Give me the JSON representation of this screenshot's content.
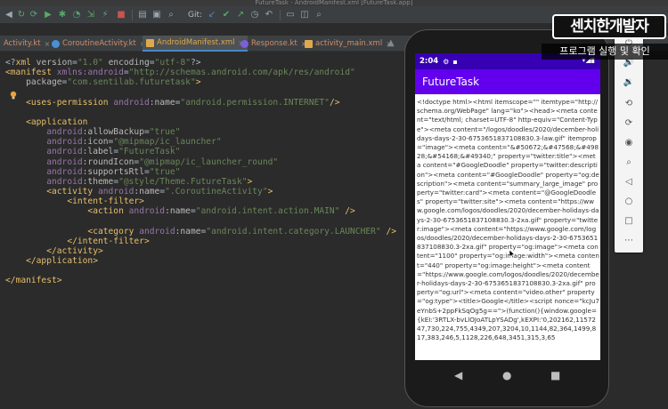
{
  "window": {
    "title": "FutureTask - AndroidManifest.xml [FutureTask.app]"
  },
  "toolbar": {
    "git_label": "Git:"
  },
  "tabs": [
    {
      "label": "Activity.kt",
      "type": "kt"
    },
    {
      "label": "CoroutineActivity.kt",
      "type": "kt"
    },
    {
      "label": "AndroidManifest.xml",
      "type": "xml"
    },
    {
      "label": "Response.kt",
      "type": "kt2"
    },
    {
      "label": "activity_main.xml",
      "type": "xml"
    }
  ],
  "editor": {
    "lines": [
      [
        [
          "t-txt",
          "<?"
        ],
        [
          "t-tag",
          "xml "
        ],
        [
          "t-attr",
          "version"
        ],
        [
          "t-txt",
          "="
        ],
        [
          "t-val",
          "\"1.0\""
        ],
        [
          "t-txt",
          " "
        ],
        [
          "t-attr",
          "encoding"
        ],
        [
          "t-txt",
          "="
        ],
        [
          "t-val",
          "\"utf-8\""
        ],
        [
          "t-txt",
          "?>"
        ]
      ],
      [
        [
          "t-tag",
          "<manifest "
        ],
        [
          "t-ns",
          "xmlns:android"
        ],
        [
          "t-txt",
          "="
        ],
        [
          "t-val",
          "\"http://schemas.android.com/apk/res/android\""
        ]
      ],
      [
        [
          "t-txt",
          "    "
        ],
        [
          "t-attr",
          "package"
        ],
        [
          "t-txt",
          "="
        ],
        [
          "t-val",
          "\"com.sentilab.futuretask\""
        ],
        [
          "t-tag",
          ">"
        ]
      ],
      [],
      [
        [
          "t-txt",
          "    "
        ],
        [
          "t-tag",
          "<uses-permission "
        ],
        [
          "t-ns",
          "android"
        ],
        [
          "t-attr",
          ":name"
        ],
        [
          "t-txt",
          "="
        ],
        [
          "t-val",
          "\"android.permission.INTERNET\""
        ],
        [
          "t-tag",
          "/>"
        ]
      ],
      [],
      [
        [
          "t-txt",
          "    "
        ],
        [
          "t-tag",
          "<application"
        ]
      ],
      [
        [
          "t-txt",
          "        "
        ],
        [
          "t-ns",
          "android"
        ],
        [
          "t-attr",
          ":allowBackup"
        ],
        [
          "t-txt",
          "="
        ],
        [
          "t-val",
          "\"true\""
        ]
      ],
      [
        [
          "t-txt",
          "        "
        ],
        [
          "t-ns",
          "android"
        ],
        [
          "t-attr",
          ":icon"
        ],
        [
          "t-txt",
          "="
        ],
        [
          "t-val",
          "\"@mipmap/ic_launcher\""
        ]
      ],
      [
        [
          "t-txt",
          "        "
        ],
        [
          "t-ns",
          "android"
        ],
        [
          "t-attr",
          ":label"
        ],
        [
          "t-txt",
          "="
        ],
        [
          "t-val",
          "\"FutureTask\""
        ]
      ],
      [
        [
          "t-txt",
          "        "
        ],
        [
          "t-ns",
          "android"
        ],
        [
          "t-attr",
          ":roundIcon"
        ],
        [
          "t-txt",
          "="
        ],
        [
          "t-val",
          "\"@mipmap/ic_launcher_round\""
        ]
      ],
      [
        [
          "t-txt",
          "        "
        ],
        [
          "t-ns",
          "android"
        ],
        [
          "t-attr",
          ":supportsRtl"
        ],
        [
          "t-txt",
          "="
        ],
        [
          "t-val",
          "\"true\""
        ]
      ],
      [
        [
          "t-txt",
          "        "
        ],
        [
          "t-ns",
          "android"
        ],
        [
          "t-attr",
          ":theme"
        ],
        [
          "t-txt",
          "="
        ],
        [
          "t-val",
          "\"@style/Theme.FutureTask\""
        ],
        [
          "t-tag",
          ">"
        ]
      ],
      [
        [
          "t-txt",
          "        "
        ],
        [
          "t-tag",
          "<activity "
        ],
        [
          "t-ns",
          "android"
        ],
        [
          "t-attr",
          ":name"
        ],
        [
          "t-txt",
          "="
        ],
        [
          "t-val",
          "\".CoroutineActivity\""
        ],
        [
          "t-tag",
          ">"
        ]
      ],
      [
        [
          "t-txt",
          "            "
        ],
        [
          "t-tag",
          "<intent-filter>"
        ]
      ],
      [
        [
          "t-txt",
          "                "
        ],
        [
          "t-tag",
          "<action "
        ],
        [
          "t-ns",
          "android"
        ],
        [
          "t-attr",
          ":name"
        ],
        [
          "t-txt",
          "="
        ],
        [
          "t-val",
          "\"android.intent.action.MAIN\""
        ],
        [
          "t-txt",
          " "
        ],
        [
          "t-tag",
          "/>"
        ]
      ],
      [],
      [
        [
          "t-txt",
          "                "
        ],
        [
          "t-tag",
          "<category "
        ],
        [
          "t-ns",
          "android"
        ],
        [
          "t-attr",
          ":name"
        ],
        [
          "t-txt",
          "="
        ],
        [
          "t-val",
          "\"android.intent.category.LAUNCHER\""
        ],
        [
          "t-txt",
          " "
        ],
        [
          "t-tag",
          "/>"
        ]
      ],
      [
        [
          "t-txt",
          "            "
        ],
        [
          "t-tag",
          "</intent-filter>"
        ]
      ],
      [
        [
          "t-txt",
          "        "
        ],
        [
          "t-tag",
          "</activity>"
        ]
      ],
      [
        [
          "t-txt",
          "    "
        ],
        [
          "t-tag",
          "</application>"
        ]
      ],
      [],
      [
        [
          "t-tag",
          "</manifest>"
        ]
      ]
    ]
  },
  "phone": {
    "status_time": "2:04",
    "app_title": "FutureTask",
    "content_text": "<!doctype html><html itemscope=\"\" itemtype=\"http://schema.org/WebPage\" lang=\"ko\"><head><meta content=\"text/html; charset=UTF-8\" http-equiv=\"Content-Type\"><meta content=\"/logos/doodles/2020/december-holidays-days-2-30-6753651837108830.3-law.gif\" itemprop=\"image\"><meta content=\"&#50672;&#47568;&#49828;&#54168;&#49340;\" property=\"twitter:title\"><meta content=\"#GoogleDoodle\" property=\"twitter:description\"><meta content=\"#GoogleDoodle\" property=\"og:description\"><meta content=\"summary_large_image\" property=\"twitter:card\"><meta content=\"@GoogleDoodles\" property=\"twitter:site\"><meta content=\"https://www.google.com/logos/doodles/2020/december-holidays-days-2-30-6753651837108830.3-2xa.gif\" property=\"twitter:image\"><meta content=\"https://www.google.com/logos/doodles/2020/december-holidays-days-2-30-6753651837108830.3-2xa.gif\" property=\"og:image\"><meta content=\"1100\" property=\"og:image:width\"><meta content=\"440\" property=\"og:image:height\"><meta content=\"https://www.google.com/logos/doodles/2020/december-holidays-days-2-30-6753651837108830.3-2xa.gif\" property=\"og:url\"><meta content=\"video.other\" property=\"og:type\"><title>Google</title><script nonce=\"kcJu7eYnbS+2ppFkSqOg5g==\">(function(){window.google={kEI:'3RTLX-bvLlOJoATLpYSADg',kEXPI:'0,202162,1157247,730,224,755,4349,207,3204,10,1144,82,364,1499,817,383,246,5,1128,226,648,3451,315,3,65"
  },
  "overlay": {
    "channel_logo": "센치한개발자",
    "subtitle": "프로그램 실행 및 확인"
  },
  "colors": {
    "status_bar": "#3700b3",
    "app_bar": "#6200ee",
    "editor_bg": "#2b2b2b"
  }
}
